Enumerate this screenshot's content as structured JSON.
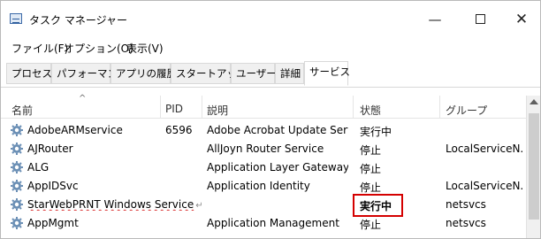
{
  "window": {
    "title": "タスク マネージャー"
  },
  "titlebar": {
    "minimize": "—",
    "close": "✕"
  },
  "menu": [
    "ファイル(F)",
    "オプション(O)",
    "表示(V)"
  ],
  "tabs": [
    "プロセス",
    "パフォーマンス",
    "アプリの履歴",
    "スタートアップ",
    "ユーザー",
    "詳細",
    "サービス"
  ],
  "active_tab": "サービス",
  "columns": {
    "name": "名前",
    "pid": "PID",
    "desc": "説明",
    "state": "状態",
    "group": "グループ"
  },
  "rows": [
    {
      "name": "AdobeARMservice",
      "pid": "6596",
      "desc": "Adobe Acrobat Update Service",
      "state": "実行中",
      "group": ""
    },
    {
      "name": "AJRouter",
      "pid": "",
      "desc": "AllJoyn Router Service",
      "state": "停止",
      "group": "LocalServiceN..."
    },
    {
      "name": "ALG",
      "pid": "",
      "desc": "Application Layer Gateway Se...",
      "state": "停止",
      "group": ""
    },
    {
      "name": "AppIDSvc",
      "pid": "",
      "desc": "Application Identity",
      "state": "停止",
      "group": "LocalServiceN..."
    },
    {
      "name": "StarWebPRNT Windows Service",
      "pid": "",
      "desc": "",
      "state": "実行中",
      "group": "netsvcs"
    },
    {
      "name": "AppMgmt",
      "pid": "",
      "desc": "Application Management",
      "state": "停止",
      "group": "netsvcs"
    }
  ],
  "highlight": {
    "row_index": 4,
    "color": "#d40000"
  },
  "colors": {
    "accent": "#d40000",
    "icon_gear": "#6b8fb5"
  }
}
